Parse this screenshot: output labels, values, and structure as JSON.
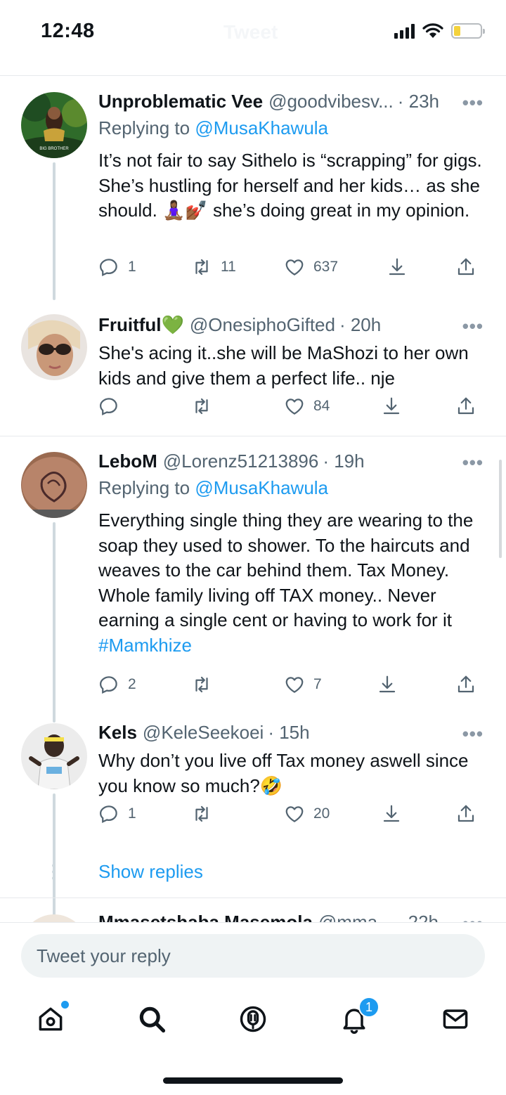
{
  "status_bar": {
    "time": "12:48",
    "ghost_title": "Tweet"
  },
  "tweets": [
    {
      "name": "Unproblematic Vee",
      "handle": "@goodvibesv...",
      "time": "· 23h",
      "replying_prefix": "Replying to ",
      "replying_to": "@MusaKhawula",
      "text": "It’s not fair to say Sithelo is “scrapping” for gigs. She’s hustling for herself and her kids… as she should. 🧘🏾‍♀️💅🏾 she’s doing great in my opinion.",
      "replies": "1",
      "retweets": "11",
      "likes": "637"
    },
    {
      "name": "Fruitful💚",
      "handle": "@OnesiphoGifted",
      "time": "· 20h",
      "text": "She's acing it..she will be MaShozi to her own kids and give them a perfect life.. nje",
      "replies": "",
      "retweets": "",
      "likes": "84"
    },
    {
      "name": "LeboM",
      "handle": "@Lorenz51213896",
      "time": "· 19h",
      "replying_prefix": "Replying to ",
      "replying_to": "@MusaKhawula",
      "text": "Everything single thing they are wearing to the soap they used to shower. To the haircuts and weaves to the car behind them. Tax Money. Whole family living off TAX money.. Never earning a single cent or having to work for it ",
      "hashtag": "#Mamkhize",
      "replies": "2",
      "retweets": "",
      "likes": "7"
    },
    {
      "name": "Kels",
      "handle": "@KeleSeekoei",
      "time": "· 15h",
      "text": "Why don’t you live off Tax money aswell since you know so much?🤣",
      "replies": "1",
      "retweets": "",
      "likes": "20"
    },
    {
      "name": "Mmasetshaba Masemola",
      "handle": "@mma...",
      "time": "· 22h"
    }
  ],
  "show_replies": "Show replies",
  "more_glyph": "•••",
  "reply_bar": {
    "placeholder": "Tweet your reply"
  },
  "tab_bar": {
    "notifications_badge": "1"
  },
  "colors": {
    "accent": "#1d9bf0",
    "text": "#0f1419",
    "muted": "#536471"
  },
  "icons": [
    "reply-icon",
    "retweet-icon",
    "like-icon",
    "bookmark-icon",
    "share-icon",
    "home-icon",
    "search-icon",
    "spaces-icon",
    "bell-icon",
    "mail-icon"
  ]
}
